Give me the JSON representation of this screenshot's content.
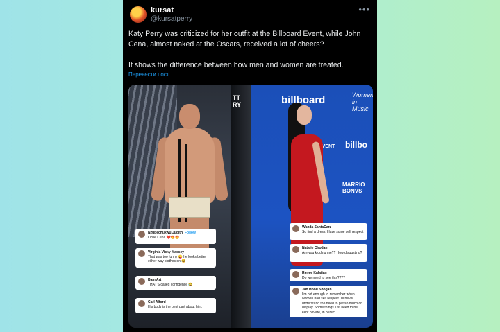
{
  "post": {
    "display_name": "kursat",
    "handle": "@kursatperry",
    "more_icon": "more-icon",
    "text_line1": "Katy Perry was criticized for her outfit at the Billboard Event, while John Cena, almost naked at the Oscars, received a lot of cheers?",
    "text_line2": "It shows the difference between how men and women are treated.",
    "translate_label": "Перевести пост"
  },
  "image_left": {
    "backdrop_text": "TT\nRY",
    "comments": [
      {
        "name": "Nzubechukwu Judith",
        "follow": "Follow",
        "body": "I love Cena ❤️😍😍"
      },
      {
        "name": "Virginia Vicky Massey",
        "body": "That was too funny 😜 he looks better either way clothes on 😂"
      },
      {
        "name": "Bam Art",
        "body": "THAT'S called confidence 😂"
      },
      {
        "name": "Carl Alford",
        "body": "His body is the best part about him."
      }
    ]
  },
  "image_right": {
    "billboard_top": "billboard",
    "women_in_music": "Women in Music",
    "billboard_side": "billbo",
    "marriott": "MARRIO BONVS",
    "event_text": "EVENT",
    "comments": [
      {
        "name": "Wanda SantaCarz",
        "body": "So find a dress. Have some self respect"
      },
      {
        "name": "Natalie Chodan",
        "body": "Are you kidding me?? How disgusting?"
      },
      {
        "name": "Renee Kalajian",
        "body": "Do we need to see this????"
      },
      {
        "name": "Jan Hood Shogan",
        "body": "I'm old enough to remember when women had self respect. I'll never understand the need to put so much on display. Some things just need to be kept private, in public."
      }
    ]
  }
}
